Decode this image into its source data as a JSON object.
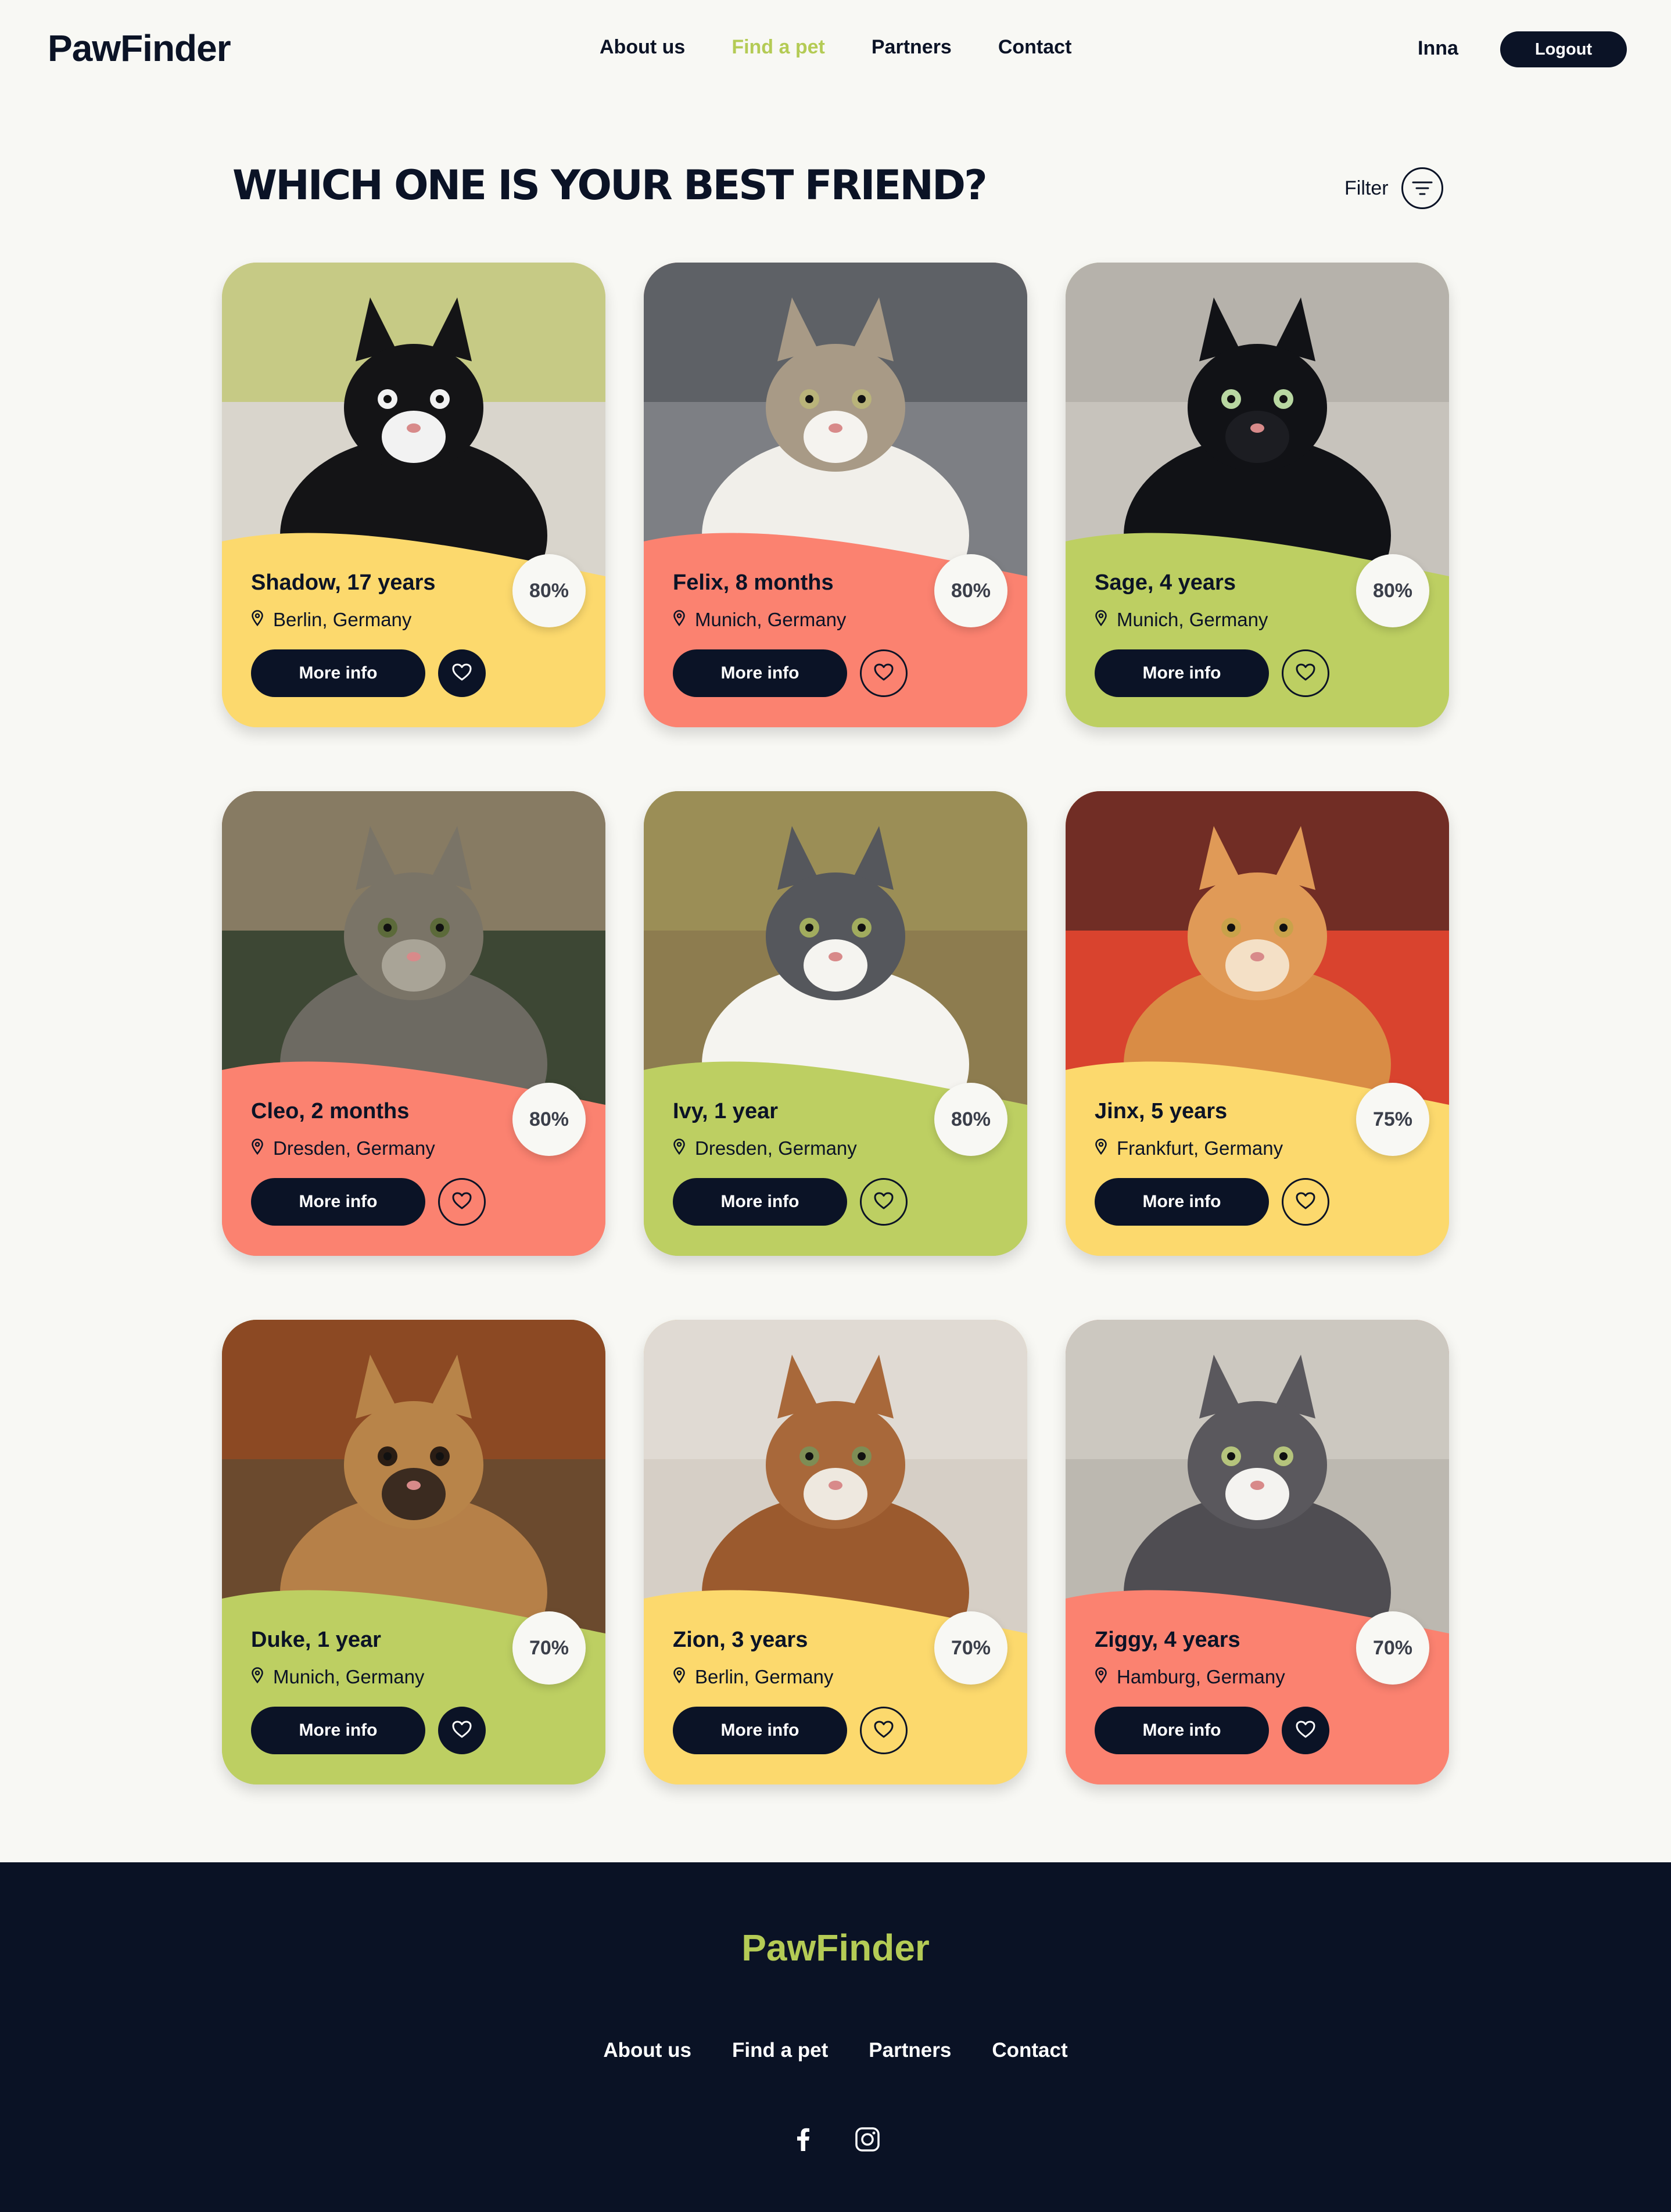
{
  "header": {
    "logo": "PawFinder",
    "nav": [
      "About us",
      "Find a pet",
      "Partners",
      "Contact"
    ],
    "active_nav": "Find a pet",
    "user": "Inna",
    "logout": "Logout"
  },
  "main": {
    "title": "WHICH ONE IS YOUR BEST FRIEND?",
    "filter_label": "Filter",
    "more_info_label": "More info",
    "pets": [
      {
        "name": "Shadow, 17 years",
        "location": "Berlin, Germany",
        "match": "80%",
        "color": "#fcd96d",
        "photo": "black-white-cat",
        "favorited": true
      },
      {
        "name": "Felix, 8 months",
        "location": "Munich, Germany",
        "match": "80%",
        "color": "#fb8270",
        "photo": "tabby-white-kitten",
        "favorited": false
      },
      {
        "name": "Sage, 4 years",
        "location": "Munich, Germany",
        "match": "80%",
        "color": "#bdcf62",
        "photo": "black-cat",
        "favorited": false
      },
      {
        "name": "Cleo, 2 months",
        "location": "Dresden, Germany",
        "match": "80%",
        "color": "#fb8270",
        "photo": "tabby-kitten-christmas",
        "favorited": false
      },
      {
        "name": "Ivy, 1 year",
        "location": "Dresden, Germany",
        "match": "80%",
        "color": "#bdcf62",
        "photo": "grey-white-cat",
        "favorited": false
      },
      {
        "name": "Jinx, 5 years",
        "location": "Frankfurt, Germany",
        "match": "75%",
        "color": "#fcd96d",
        "photo": "orange-cat",
        "favorited": false
      },
      {
        "name": "Duke, 1 year",
        "location": "Munich, Germany",
        "match": "70%",
        "color": "#bdcf62",
        "photo": "dog-red-bandana",
        "favorited": true
      },
      {
        "name": "Zion, 3 years",
        "location": "Berlin, Germany",
        "match": "70%",
        "color": "#fcd96d",
        "photo": "bengal-cat",
        "favorited": false
      },
      {
        "name": "Ziggy, 4 years",
        "location": "Hamburg, Germany",
        "match": "70%",
        "color": "#fb8270",
        "photo": "grey-white-cat-lying",
        "favorited": true
      }
    ]
  },
  "footer": {
    "logo": "PawFinder",
    "nav": [
      "About us",
      "Find a pet",
      "Partners",
      "Contact"
    ],
    "social": [
      "facebook-icon",
      "instagram-icon"
    ]
  },
  "colors": {
    "navy": "#0b1326",
    "accent_green": "#b4cb55",
    "yellow": "#fcd96d",
    "salmon": "#fb8270",
    "green": "#bdcf62",
    "background": "#f8f8f4"
  }
}
